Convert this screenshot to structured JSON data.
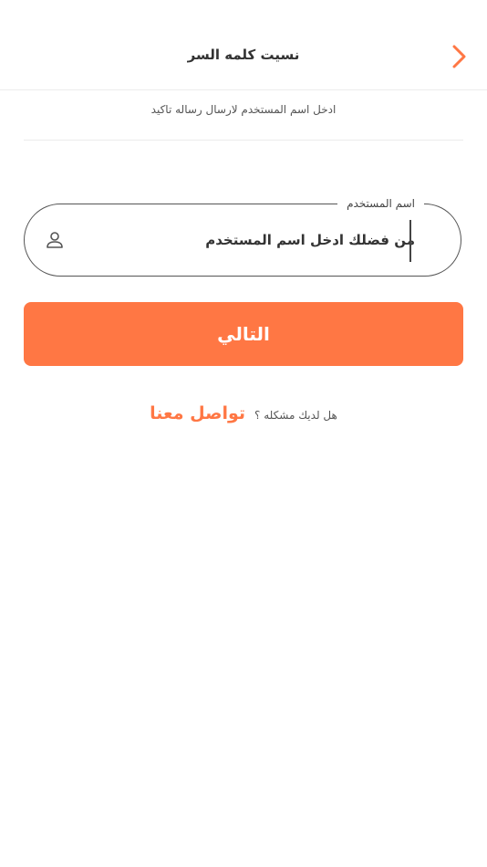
{
  "header": {
    "title": "نسيت كلمه السر",
    "back_icon": "chevron-right-icon",
    "accent_color": "#ff7744"
  },
  "subtitle": "ادخل اسم المستخدم لارسال رساله تاكيد",
  "username_field": {
    "label": "اسم المستخدم",
    "placeholder": "من فضلك ادخل اسم المستخدم",
    "value": "",
    "icon": "user-icon"
  },
  "next_button": {
    "label": "التالي",
    "color": "#ff7744"
  },
  "help": {
    "question": "هل لديك مشكله ؟",
    "contact_label": "تواصل معنا"
  }
}
